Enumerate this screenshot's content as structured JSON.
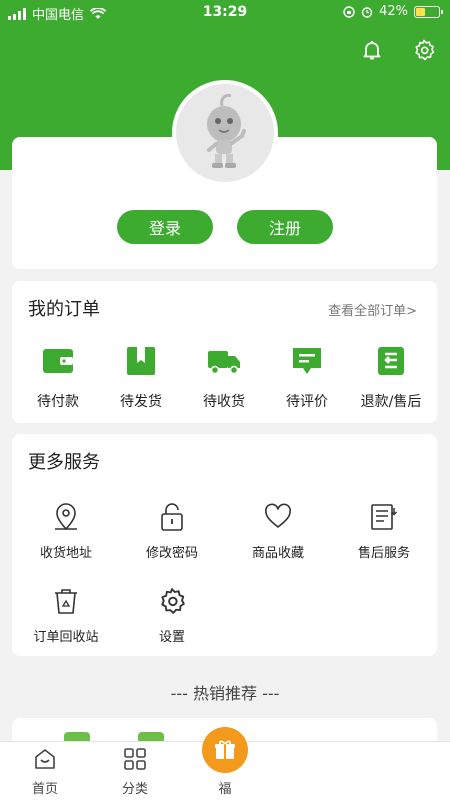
{
  "status": {
    "carrier": "中国电信",
    "time": "13:29",
    "battery": "42%",
    "battery_level": 0.42
  },
  "header": {
    "bell_icon": "bell-icon",
    "settings_icon": "gear-icon"
  },
  "profile": {
    "login_label": "登录",
    "register_label": "注册"
  },
  "orders": {
    "title": "我的订单",
    "view_all": "查看全部订单>",
    "items": [
      {
        "label": "待付款",
        "icon": "wallet-icon"
      },
      {
        "label": "待发货",
        "icon": "package-icon"
      },
      {
        "label": "待收货",
        "icon": "truck-icon"
      },
      {
        "label": "待评价",
        "icon": "comment-icon"
      },
      {
        "label": "退款/售后",
        "icon": "refund-icon"
      }
    ]
  },
  "services": {
    "title": "更多服务",
    "items": [
      {
        "label": "收货地址",
        "icon": "location-icon"
      },
      {
        "label": "修改密码",
        "icon": "lock-icon"
      },
      {
        "label": "商品收藏",
        "icon": "heart-icon"
      },
      {
        "label": "售后服务",
        "icon": "after-sale-icon"
      },
      {
        "label": "订单回收站",
        "icon": "recycle-bin-icon"
      },
      {
        "label": "设置",
        "icon": "gear-icon"
      }
    ]
  },
  "hot": {
    "title": "--- 热销推荐 ---"
  },
  "tabs": [
    {
      "label": "首页",
      "icon": "home-icon"
    },
    {
      "label": "分类",
      "icon": "category-icon"
    },
    {
      "label": "福",
      "icon": "gift-icon"
    }
  ],
  "colors": {
    "brand_green": "#3dab2f",
    "accent_orange": "#f39a1d"
  }
}
